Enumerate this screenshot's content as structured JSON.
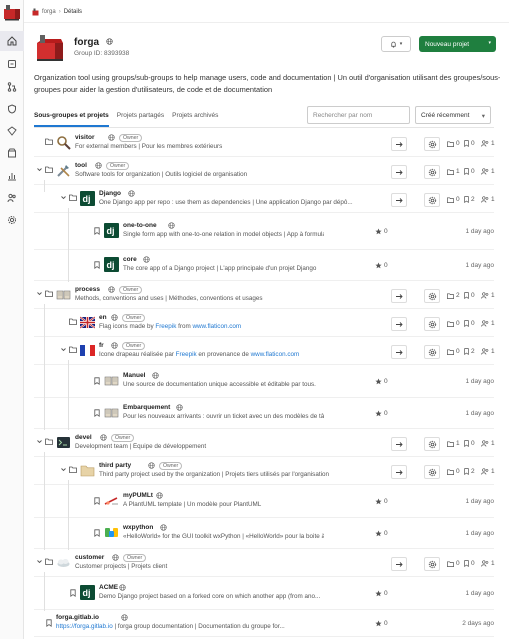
{
  "breadcrumb": {
    "root": "forga",
    "current": "Détails"
  },
  "group": {
    "name": "forga",
    "id_label": "Group ID: 8393938",
    "description": "Organization tool using groups/sub-groups to help manage users, code and documentation | Un outil d'organisation utilisant des groupes/sous-groupes pour aider la gestion d'utilisateurs, de code et de documentation"
  },
  "actions": {
    "new_project": "Nouveau projet"
  },
  "tabs": [
    "Sous-groupes et projets",
    "Projets partagés",
    "Projets archivés"
  ],
  "search": {
    "placeholder": "Rechercher par nom"
  },
  "sort": {
    "selected": "Créé récemment"
  },
  "rows": [
    {
      "name": "visitor",
      "role": "Owner",
      "desc": "For external members | Pour les membres extérieurs",
      "counts": [
        "0",
        "0",
        "1"
      ]
    },
    {
      "name": "tool",
      "role": "Owner",
      "desc": "Software tools for organization | Outils logiciel de organisation",
      "counts": [
        "1",
        "0",
        "1"
      ]
    },
    {
      "name": "Django",
      "desc": "One Django app per repo : use them as dependencies | Une application Django par dépô...",
      "counts": [
        "0",
        "2",
        "1"
      ]
    },
    {
      "name": "one-to-one",
      "desc": "Single form app with one-to-one relation in model objects | App à formulai...",
      "stars": "0",
      "age": "1 day ago"
    },
    {
      "name": "core",
      "desc": "The core app of a Django project | L'app principale d'un projet Django",
      "stars": "0",
      "age": "1 day ago"
    },
    {
      "name": "process",
      "role": "Owner",
      "desc": "Methods, conventions and uses | Méthodes, conventions et usages",
      "counts": [
        "2",
        "0",
        "1"
      ]
    },
    {
      "name": "en",
      "role": "Owner",
      "desc_pre": "Flag icons made by ",
      "desc_link1": "Freepik",
      "desc_mid": " from ",
      "desc_link2": "www.flaticon.com",
      "counts": [
        "0",
        "0",
        "1"
      ]
    },
    {
      "name": "fr",
      "role": "Owner",
      "desc_pre": "Icone drapeau réalisée par ",
      "desc_link1": "Freepik",
      "desc_mid": " en provenance de ",
      "desc_link2": "www.flaticon.com",
      "counts": [
        "0",
        "2",
        "1"
      ]
    },
    {
      "name": "Manuel",
      "desc": "Une source de documentation unique accessible et éditable par tous.",
      "stars": "0",
      "age": "1 day ago"
    },
    {
      "name": "Embarquement",
      "desc": "Pour les nouveaux arrivants : ouvrir un ticket avec un des modèles de tâc...",
      "stars": "0",
      "age": "1 day ago"
    },
    {
      "name": "devel",
      "role": "Owner",
      "desc": "Development team | Équipe de développement",
      "counts": [
        "1",
        "0",
        "1"
      ]
    },
    {
      "name": "third party",
      "role": "Owner",
      "desc": "Third party project used by the organization | Projets tiers utilisés par l'organisation",
      "counts": [
        "0",
        "2",
        "1"
      ]
    },
    {
      "name": "myPUMLt",
      "desc": "A PlantUML template | Un modèle pour PlantUML",
      "stars": "0",
      "age": "1 day ago"
    },
    {
      "name": "wxpython",
      "desc": "«HelloWorld» for the GUI toolkit wxPython | «HelloWorld» pour la boite à ...",
      "stars": "0",
      "age": "1 day ago"
    },
    {
      "name": "customer",
      "role": "Owner",
      "desc": "Customer projects | Projets client",
      "counts": [
        "0",
        "0",
        "1"
      ]
    },
    {
      "name": "ACME",
      "desc": "Demo Django project based on a forked core on which another app (from ano...",
      "stars": "0",
      "age": "1 day ago"
    },
    {
      "name": "forga.gitlab.io",
      "desc_link1": "https://forga.gitlab.io",
      "desc_mid": " | forga group documentation | Documentation du groupe for...",
      "stars": "0",
      "age": "2 days ago"
    }
  ]
}
